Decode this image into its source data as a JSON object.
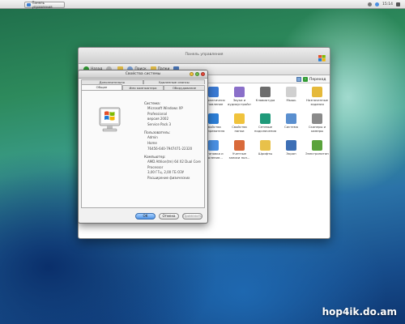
{
  "menubar": {
    "apple_glyph": "",
    "task_label": "Панель управления",
    "clock": "15:14"
  },
  "control_panel": {
    "title": "Панель управления",
    "toolbar": {
      "back": "Назад",
      "forward": "",
      "search": "Поиск",
      "folders": "Папки"
    },
    "go_label": "Переход",
    "items": [
      {
        "label": "Автоматическое обновление",
        "icon": "update-icon",
        "color": "#3b7bd4"
      },
      {
        "label": "Звуки и аудиоустройства",
        "icon": "speaker-icon",
        "color": "#8a6fc9"
      },
      {
        "label": "Клавиатура",
        "icon": "keyboard-icon",
        "color": "#6c6c6c"
      },
      {
        "label": "Мышь",
        "icon": "mouse-icon",
        "color": "#d0d0d0"
      },
      {
        "label": "Назначенные задания",
        "icon": "tasks-icon",
        "color": "#e5b93a"
      },
      {
        "label": "Свойства обозревателя",
        "icon": "globe-icon",
        "color": "#2d7fd6"
      },
      {
        "label": "Свойства папки",
        "icon": "folder-icon",
        "color": "#f0c33c"
      },
      {
        "label": "Сетевые подключения",
        "icon": "network-icon",
        "color": "#1f9a7a"
      },
      {
        "label": "Система",
        "icon": "system-icon",
        "color": "#5a8fcf"
      },
      {
        "label": "Сканеры и камеры",
        "icon": "camera-icon",
        "color": "#8a8a8a"
      },
      {
        "label": "Установка и удаление...",
        "icon": "install-icon",
        "color": "#4a90e2"
      },
      {
        "label": "Учетные записи пол...",
        "icon": "users-icon",
        "color": "#d96a3a"
      },
      {
        "label": "Шрифты",
        "icon": "fonts-icon",
        "color": "#e8c14a"
      },
      {
        "label": "Экран",
        "icon": "display-icon",
        "color": "#3d6fb5"
      },
      {
        "label": "Электропитание",
        "icon": "power-icon",
        "color": "#5aa33c"
      }
    ]
  },
  "system_dialog": {
    "title": "Свойства системы",
    "tabs_top": [
      "Дополнительно",
      "Удаленные сеансы"
    ],
    "tabs_bottom": [
      "Общие",
      "Имя компьютера",
      "Оборудование"
    ],
    "active_tab": "Общие",
    "system": {
      "heading": "Система:",
      "lines": [
        "Microsoft Windows XP",
        "Professional",
        "версия 2002",
        "Service Pack 3"
      ]
    },
    "user": {
      "heading": "Пользователь:",
      "lines": [
        "Admin",
        "Home",
        "76456-640-7947471-22320"
      ]
    },
    "computer": {
      "heading": "Компьютер:",
      "lines": [
        "AMD Athlon(tm) 64 X2 Dual Core",
        "Processor",
        "3,00 ГГц, 2,00 ГБ ОЗУ",
        "Расширение физических"
      ]
    },
    "buttons": {
      "ok": "ОК",
      "cancel": "Отмена",
      "apply": "Применить"
    }
  },
  "watermark": "hop4ik.do.am"
}
